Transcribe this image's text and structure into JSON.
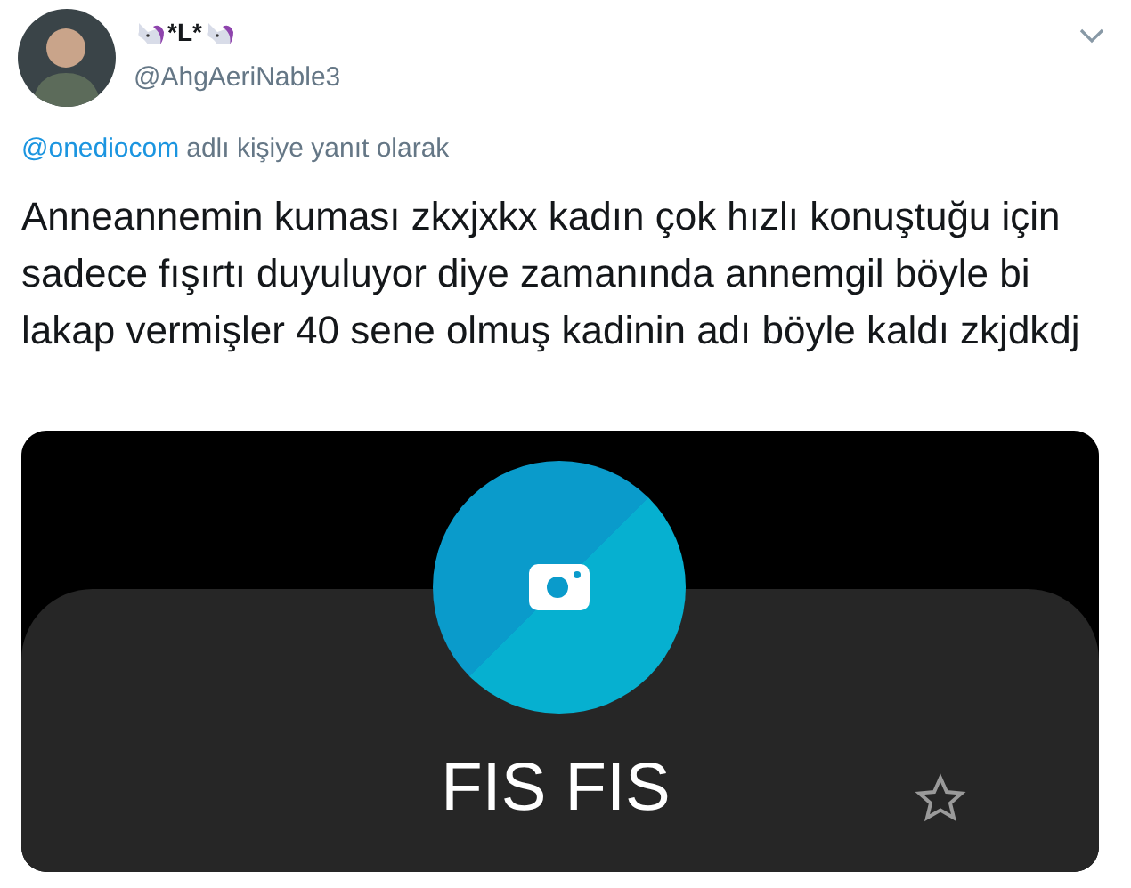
{
  "author": {
    "display_name": "*L*",
    "handle": "@AhgAeriNable3"
  },
  "reply_to": {
    "mention": "@onediocom",
    "text": "adlı kişiye yanıt olarak"
  },
  "tweet_text": "Anneannemin kuması zkxjxkx kadın çok hızlı konuştuğu için sadece fışırtı duyuluyor diye zamanında annemgil böyle bi lakap vermişler 40 sene olmuş kadinin adı böyle kaldı zkjdkdj",
  "contact_card": {
    "name": "FIS FIS",
    "favorite": false
  }
}
